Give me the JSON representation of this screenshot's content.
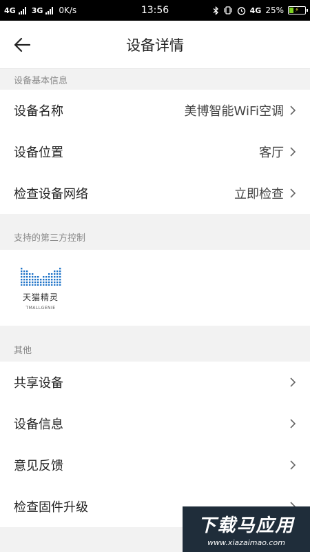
{
  "statusbar": {
    "net1": "4G",
    "net2": "3G",
    "speed": "0K/s",
    "time": "13:56",
    "net3": "4G",
    "battery": "25%"
  },
  "header": {
    "title": "设备详情"
  },
  "basic": {
    "section": "设备基本信息",
    "rows": [
      {
        "label": "设备名称",
        "value": "美博智能WiFi空调"
      },
      {
        "label": "设备位置",
        "value": "客厅"
      },
      {
        "label": "检查设备网络",
        "value": "立即检查"
      }
    ]
  },
  "thirdparty": {
    "section": "支持的第三方控制",
    "logo_cn": "天猫精灵",
    "logo_en": "TMALLGENIE"
  },
  "other": {
    "section": "其他",
    "rows": [
      {
        "label": "共享设备"
      },
      {
        "label": "设备信息"
      },
      {
        "label": "意见反馈"
      },
      {
        "label": "检查固件升级"
      }
    ]
  },
  "watermark": {
    "cn": "下载马应用",
    "url": "www.xiazaimao.com"
  },
  "colors": {
    "accent_blue": "#1e73c8",
    "background": "#f2f2f2"
  }
}
